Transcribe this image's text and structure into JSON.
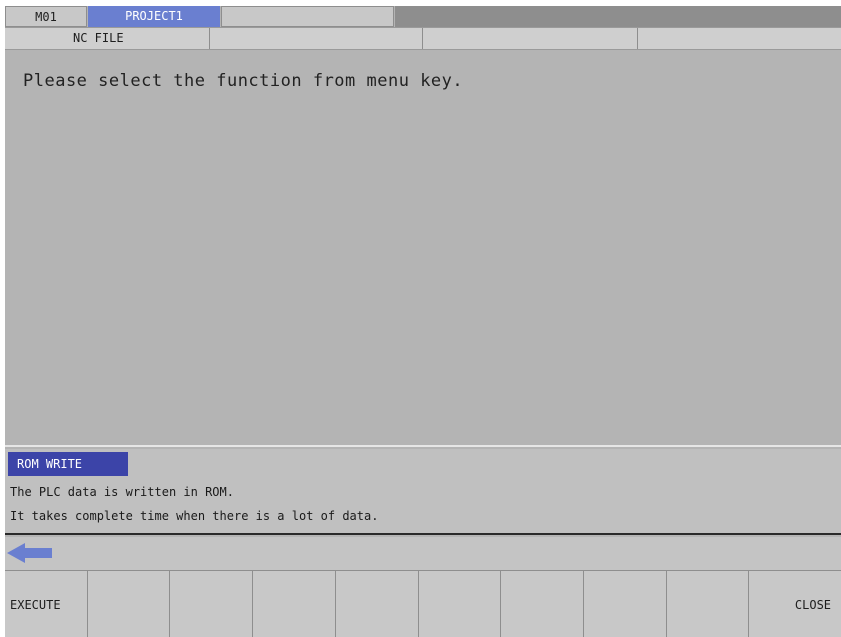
{
  "header": {
    "tabs": [
      "M01",
      "PROJECT1",
      "",
      ""
    ],
    "file_row": [
      "NC FILE",
      "",
      "",
      ""
    ]
  },
  "main": {
    "message": "Please select the function from menu key."
  },
  "info": {
    "title": "ROM WRITE",
    "lines": [
      "The PLC data is written in ROM.",
      "It takes complete time when there is a lot of data."
    ]
  },
  "nav": {
    "arrow_icon": "left-arrow-icon",
    "arrow_color": "#6a7fd0"
  },
  "menu_keys": [
    "EXECUTE",
    "",
    "",
    "",
    "",
    "",
    "",
    "",
    "",
    "CLOSE"
  ],
  "colors": {
    "active_tab": "#6a7fd0",
    "info_title_bg": "#3c44a8",
    "background": "#b4b4b4"
  }
}
